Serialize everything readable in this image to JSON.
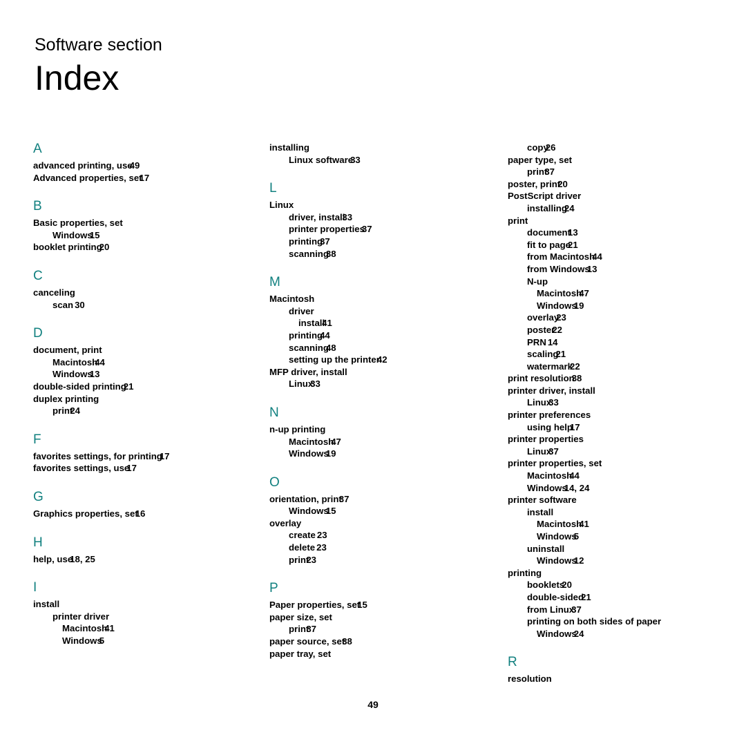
{
  "header": {
    "section_label": "Software section",
    "title": "Index"
  },
  "folio": "49",
  "accent_color": "#11807f",
  "columns": [
    {
      "name": "column-1",
      "blocks": [
        {
          "letter": "A",
          "entries": [
            {
              "level": 0,
              "text": "advanced printing, use",
              "page": "49"
            },
            {
              "level": 0,
              "text": "Advanced properties, set",
              "page": "17"
            }
          ]
        },
        {
          "letter": "B",
          "entries": [
            {
              "level": 0,
              "text": "Basic properties, set",
              "page": ""
            },
            {
              "level": 1,
              "text": "Windows",
              "page": "15"
            },
            {
              "level": 0,
              "text": "booklet printing",
              "page": "20"
            }
          ]
        },
        {
          "letter": "C",
          "entries": [
            {
              "level": 0,
              "text": "canceling",
              "page": ""
            },
            {
              "level": 1,
              "text": "scan",
              "page": "30",
              "space": true
            }
          ]
        },
        {
          "letter": "D",
          "entries": [
            {
              "level": 0,
              "text": "document, print",
              "page": ""
            },
            {
              "level": 1,
              "text": "Macintosh",
              "page": "44"
            },
            {
              "level": 1,
              "text": "Windows",
              "page": "13"
            },
            {
              "level": 0,
              "text": "double-sided printing",
              "page": "21"
            },
            {
              "level": 0,
              "text": "duplex printing",
              "page": ""
            },
            {
              "level": 1,
              "text": "print",
              "page": "24"
            }
          ]
        },
        {
          "letter": "F",
          "entries": [
            {
              "level": 0,
              "text": "favorites settings, for printing",
              "page": "17"
            },
            {
              "level": 0,
              "text": "favorites settings, use",
              "page": "17"
            }
          ]
        },
        {
          "letter": "G",
          "entries": [
            {
              "level": 0,
              "text": "Graphics properties, set",
              "page": "16"
            }
          ]
        },
        {
          "letter": "H",
          "entries": [
            {
              "level": 0,
              "text": "help, use",
              "page": "18, 25"
            }
          ]
        },
        {
          "letter": "I",
          "entries": [
            {
              "level": 0,
              "text": "install",
              "page": ""
            },
            {
              "level": 1,
              "text": "printer driver",
              "page": ""
            },
            {
              "level": 2,
              "text": "Macintosh",
              "page": "41"
            },
            {
              "level": 2,
              "text": "Windows",
              "page": "5"
            }
          ]
        }
      ]
    },
    {
      "name": "column-2",
      "blocks": [
        {
          "letter": "",
          "entries": [
            {
              "level": 0,
              "text": "installing",
              "page": ""
            },
            {
              "level": 1,
              "text": "Linux software",
              "page": "33"
            }
          ]
        },
        {
          "letter": "L",
          "entries": [
            {
              "level": 0,
              "text": "Linux",
              "page": ""
            },
            {
              "level": 1,
              "text": "driver, install",
              "page": "33"
            },
            {
              "level": 1,
              "text": "printer properties",
              "page": "37"
            },
            {
              "level": 1,
              "text": "printing",
              "page": "37"
            },
            {
              "level": 1,
              "text": "scanning",
              "page": "38"
            }
          ]
        },
        {
          "letter": "M",
          "entries": [
            {
              "level": 0,
              "text": "Macintosh",
              "page": ""
            },
            {
              "level": 1,
              "text": "driver",
              "page": ""
            },
            {
              "level": 2,
              "text": "install",
              "page": "41"
            },
            {
              "level": 1,
              "text": "printing",
              "page": "44"
            },
            {
              "level": 1,
              "text": "scanning",
              "page": "48"
            },
            {
              "level": 1,
              "text": "setting up the printer",
              "page": "42"
            },
            {
              "level": 0,
              "text": "MFP driver, install",
              "page": ""
            },
            {
              "level": 1,
              "text": "Linux",
              "page": "33"
            }
          ]
        },
        {
          "letter": "N",
          "entries": [
            {
              "level": 0,
              "text": "n-up printing",
              "page": ""
            },
            {
              "level": 1,
              "text": "Macintosh",
              "page": "47"
            },
            {
              "level": 1,
              "text": "Windows",
              "page": "19"
            }
          ]
        },
        {
          "letter": "O",
          "entries": [
            {
              "level": 0,
              "text": "orientation, print",
              "page": "37"
            },
            {
              "level": 1,
              "text": "Windows",
              "page": "15"
            },
            {
              "level": 0,
              "text": "overlay",
              "page": ""
            },
            {
              "level": 1,
              "text": "create",
              "page": "23",
              "space": true
            },
            {
              "level": 1,
              "text": "delete",
              "page": "23",
              "space": true
            },
            {
              "level": 1,
              "text": "print",
              "page": "23"
            }
          ]
        },
        {
          "letter": "P",
          "entries": [
            {
              "level": 0,
              "text": "Paper properties, set",
              "page": "15"
            },
            {
              "level": 0,
              "text": "paper size, set",
              "page": ""
            },
            {
              "level": 1,
              "text": "print",
              "page": "37"
            },
            {
              "level": 0,
              "text": "paper source, set",
              "page": "38"
            },
            {
              "level": 0,
              "text": "paper tray, set",
              "page": ""
            }
          ]
        }
      ]
    },
    {
      "name": "column-3",
      "blocks": [
        {
          "letter": "",
          "entries": [
            {
              "level": 1,
              "text": "copy",
              "page": "26"
            },
            {
              "level": 0,
              "text": "paper type, set",
              "page": ""
            },
            {
              "level": 1,
              "text": "print",
              "page": "37"
            },
            {
              "level": 0,
              "text": "poster, print",
              "page": "20"
            },
            {
              "level": 0,
              "text": "PostScript driver",
              "page": ""
            },
            {
              "level": 1,
              "text": "installing",
              "page": "24"
            },
            {
              "level": 0,
              "text": "print",
              "page": ""
            },
            {
              "level": 1,
              "text": "document",
              "page": "13"
            },
            {
              "level": 1,
              "text": "fit to page",
              "page": "21"
            },
            {
              "level": 1,
              "text": "from Macintosh",
              "page": "44"
            },
            {
              "level": 1,
              "text": "from Windows",
              "page": "13"
            },
            {
              "level": 1,
              "text": "N-up",
              "page": ""
            },
            {
              "level": 2,
              "text": "Macintosh",
              "page": "47"
            },
            {
              "level": 2,
              "text": "Windows",
              "page": "19"
            },
            {
              "level": 1,
              "text": "overlay",
              "page": "23"
            },
            {
              "level": 1,
              "text": "poster",
              "page": "22"
            },
            {
              "level": 1,
              "text": "PRN",
              "page": "14",
              "space": true
            },
            {
              "level": 1,
              "text": "scaling",
              "page": "21"
            },
            {
              "level": 1,
              "text": "watermark",
              "page": "22"
            },
            {
              "level": 0,
              "text": "print resolution",
              "page": "38"
            },
            {
              "level": 0,
              "text": "printer driver, install",
              "page": ""
            },
            {
              "level": 1,
              "text": "Linux",
              "page": "33"
            },
            {
              "level": 0,
              "text": "printer preferences",
              "page": ""
            },
            {
              "level": 1,
              "text": "using help",
              "page": "17"
            },
            {
              "level": 0,
              "text": "printer properties",
              "page": ""
            },
            {
              "level": 1,
              "text": "Linux",
              "page": "37"
            },
            {
              "level": 0,
              "text": "printer properties, set",
              "page": ""
            },
            {
              "level": 1,
              "text": "Macintosh",
              "page": "44"
            },
            {
              "level": 1,
              "text": "Windows",
              "page": "14, 24"
            },
            {
              "level": 0,
              "text": "printer software",
              "page": ""
            },
            {
              "level": 1,
              "text": "install",
              "page": ""
            },
            {
              "level": 2,
              "text": "Macintosh",
              "page": "41"
            },
            {
              "level": 2,
              "text": "Windows",
              "page": "5"
            },
            {
              "level": 1,
              "text": "uninstall",
              "page": ""
            },
            {
              "level": 2,
              "text": "Windows",
              "page": "12"
            },
            {
              "level": 0,
              "text": "printing",
              "page": ""
            },
            {
              "level": 1,
              "text": "booklets",
              "page": "20"
            },
            {
              "level": 1,
              "text": "double-sided",
              "page": "21"
            },
            {
              "level": 1,
              "text": "from Linux",
              "page": "37"
            },
            {
              "level": 1,
              "text": "printing on both sides of paper",
              "page": ""
            },
            {
              "level": 2,
              "text": "Windows",
              "page": "24"
            }
          ]
        },
        {
          "letter": "R",
          "entries": [
            {
              "level": 0,
              "text": "resolution",
              "page": ""
            }
          ]
        }
      ]
    }
  ]
}
